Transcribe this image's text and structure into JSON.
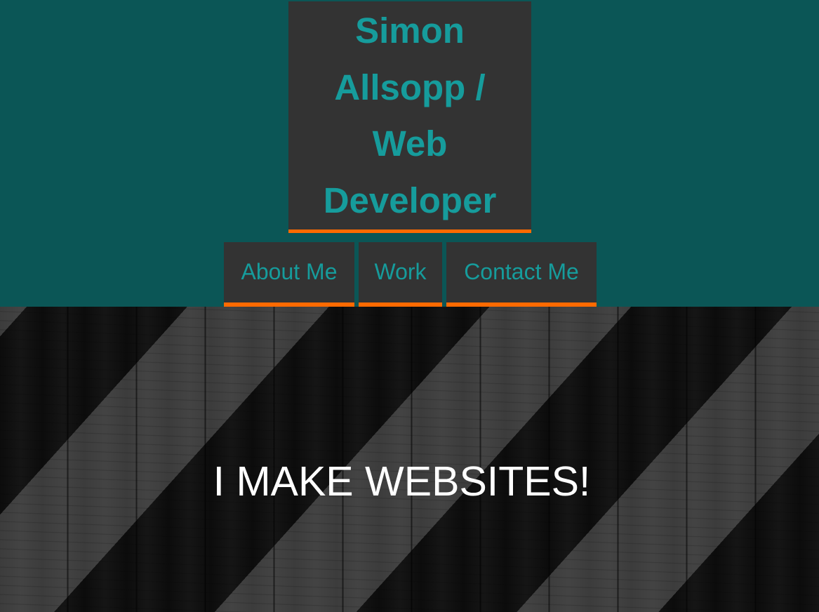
{
  "header": {
    "title_lines": [
      "Simon",
      "Allsopp /",
      "Web",
      "Developer"
    ]
  },
  "nav": {
    "items": [
      {
        "label": "About Me"
      },
      {
        "label": "Work"
      },
      {
        "label": "Contact Me"
      }
    ]
  },
  "hero": {
    "heading": "I MAKE WEBSITES!"
  },
  "colors": {
    "header_background": "#0b5656",
    "box_background": "#333333",
    "accent_text": "#169c9c",
    "underline_accent": "#ff6a00",
    "hero_text": "#ffffff"
  }
}
